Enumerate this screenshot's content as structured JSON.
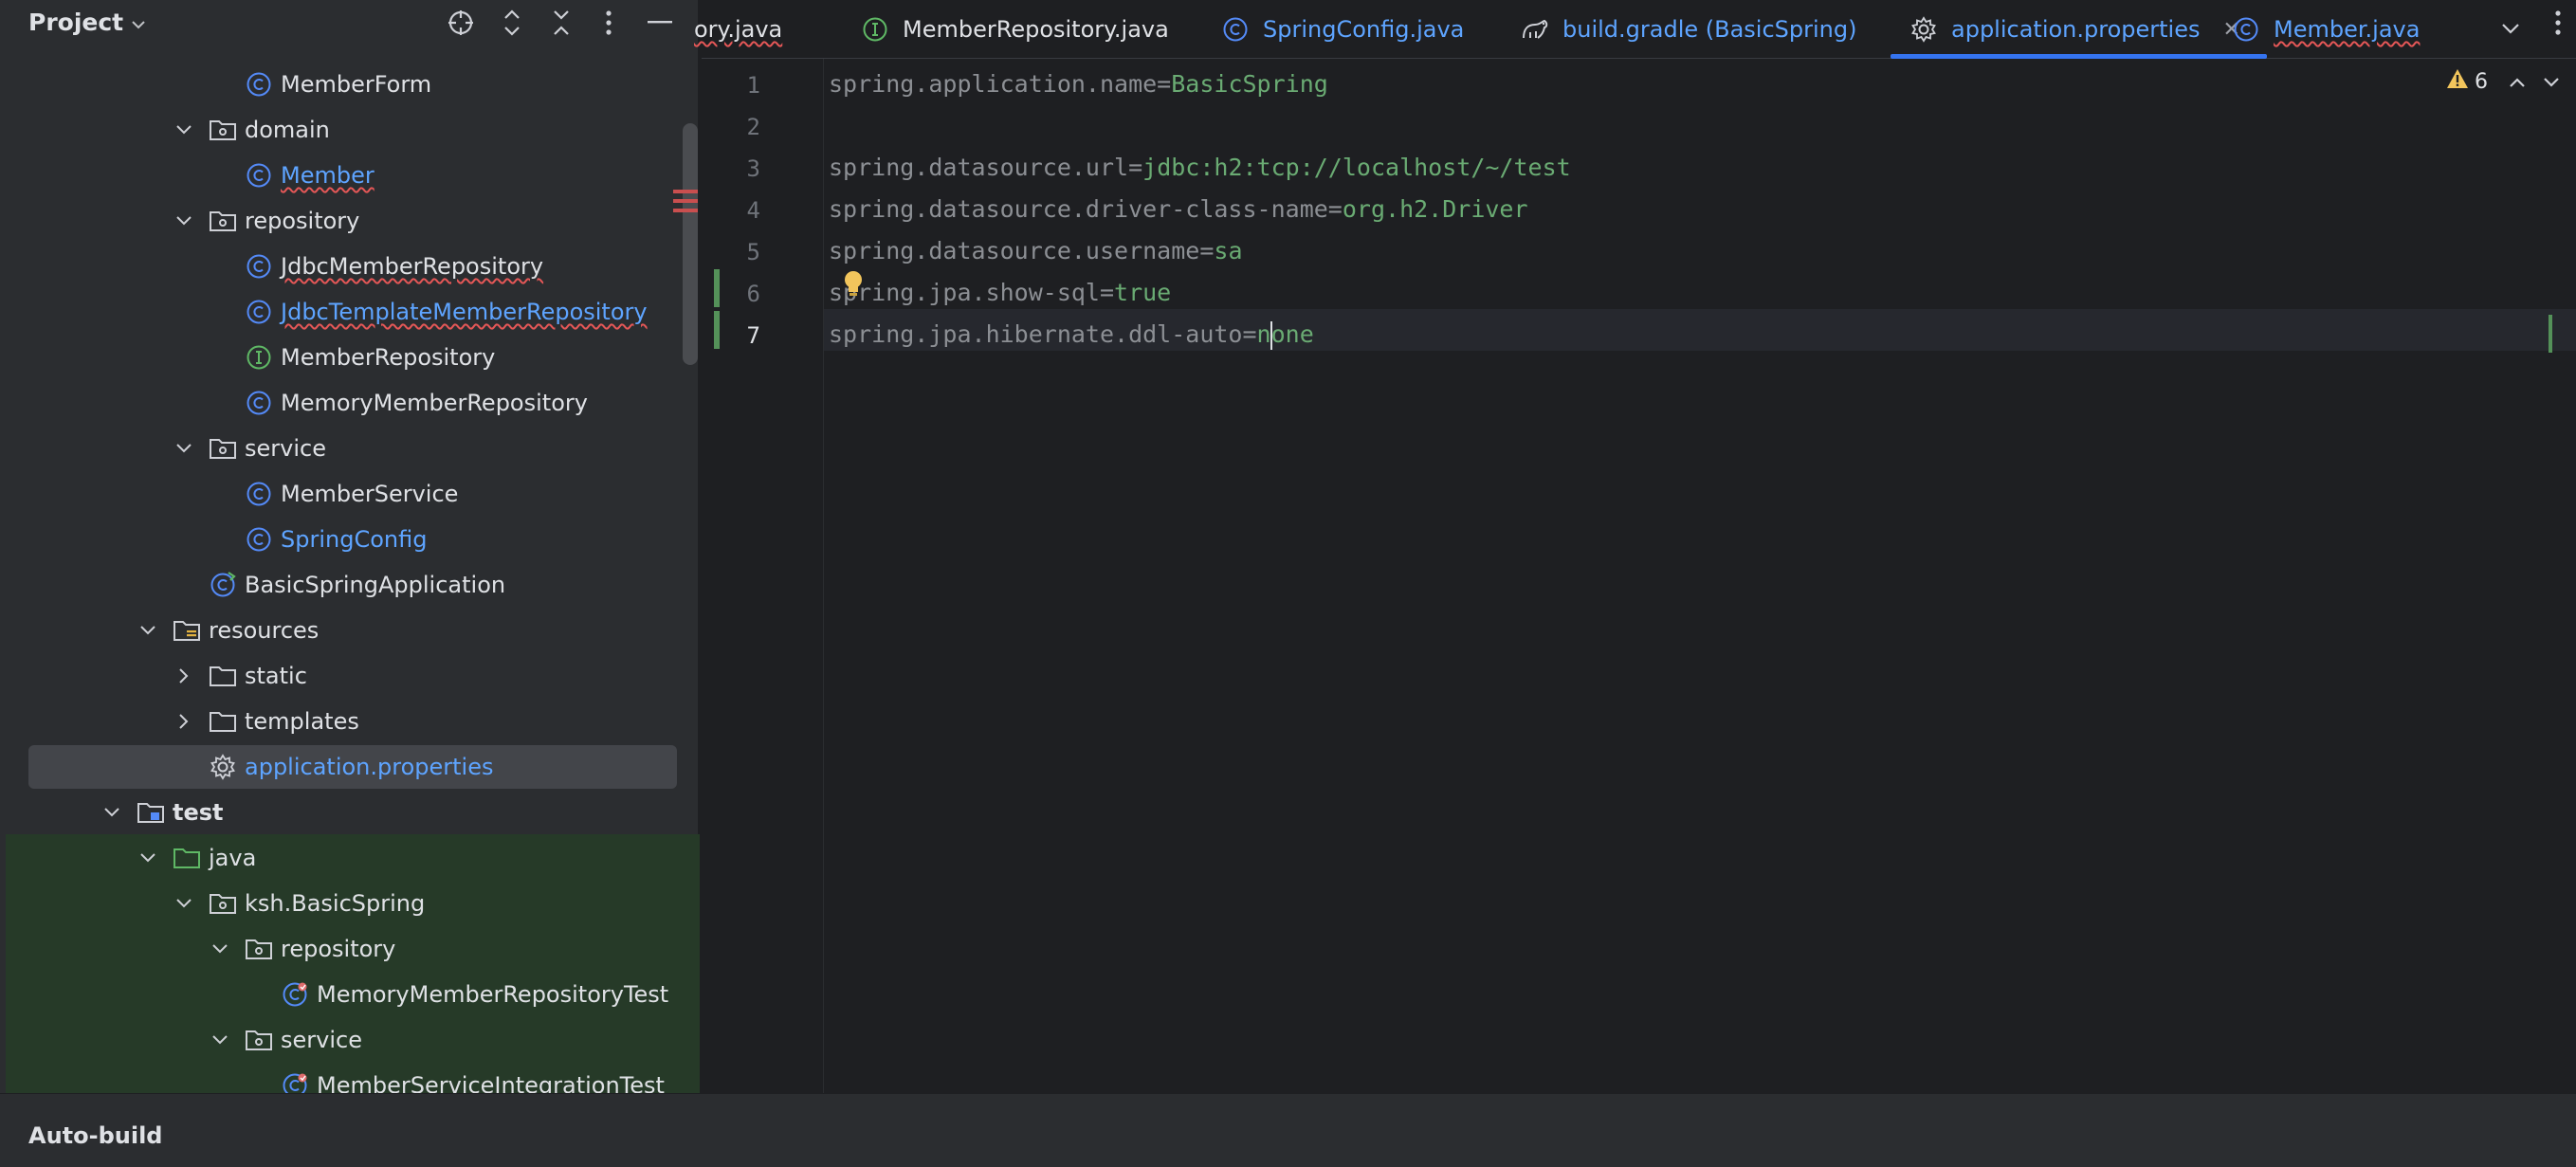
{
  "project_panel": {
    "title": "Project",
    "icons": [
      "locate-icon",
      "expand-all-icon",
      "collapse-all-icon",
      "more-options-icon",
      "minimize-icon"
    ]
  },
  "tree": [
    {
      "label": "MemberForm",
      "icon": "class-icon"
    },
    {
      "label": "domain",
      "icon": "package-icon",
      "expanded": true
    },
    {
      "label": "Member",
      "icon": "class-icon",
      "color": "blue",
      "error": true
    },
    {
      "label": "repository",
      "icon": "package-icon",
      "expanded": true
    },
    {
      "label": "JdbcMemberRepository",
      "icon": "class-icon",
      "error": true
    },
    {
      "label": "JdbcTemplateMemberRepository",
      "icon": "class-icon",
      "color": "blue",
      "error": true
    },
    {
      "label": "MemberRepository",
      "icon": "interface-icon"
    },
    {
      "label": "MemoryMemberRepository",
      "icon": "class-icon"
    },
    {
      "label": "service",
      "icon": "package-icon",
      "expanded": true
    },
    {
      "label": "MemberService",
      "icon": "class-icon"
    },
    {
      "label": "SpringConfig",
      "icon": "class-icon",
      "color": "blue"
    },
    {
      "label": "BasicSpringApplication",
      "icon": "spring-boot-class-icon"
    },
    {
      "label": "resources",
      "icon": "resources-folder-icon",
      "expanded": true
    },
    {
      "label": "static",
      "icon": "folder-icon",
      "expanded": false
    },
    {
      "label": "templates",
      "icon": "folder-icon",
      "expanded": false
    },
    {
      "label": "application.properties",
      "icon": "gear-icon",
      "color": "blue",
      "selected": true
    },
    {
      "label": "test",
      "icon": "test-module-icon",
      "expanded": true,
      "bold": true
    },
    {
      "label": "java",
      "icon": "test-folder-icon",
      "expanded": true
    },
    {
      "label": "ksh.BasicSpring",
      "icon": "package-icon",
      "expanded": true
    },
    {
      "label": "repository",
      "icon": "package-icon",
      "expanded": true
    },
    {
      "label": "MemoryMemberRepositoryTest",
      "icon": "test-class-icon"
    },
    {
      "label": "service",
      "icon": "package-icon",
      "expanded": true
    },
    {
      "label": "MemberServiceIntegrationTest",
      "icon": "test-class-icon"
    }
  ],
  "tabs": [
    {
      "label": "ory.java",
      "icon": "",
      "squiggle": true
    },
    {
      "label": "MemberRepository.java",
      "icon": "interface-icon"
    },
    {
      "label": "SpringConfig.java",
      "icon": "class-icon",
      "color": "blue"
    },
    {
      "label": "build.gradle (BasicSpring)",
      "icon": "gradle-icon",
      "color": "blue"
    },
    {
      "label": "application.properties",
      "icon": "gear-icon",
      "color": "blue",
      "active": true,
      "close": "✕"
    },
    {
      "label": "Member.java",
      "icon": "class-icon",
      "color": "blue",
      "squiggle": true
    }
  ],
  "editor": {
    "warning_count": "6",
    "current_line": 7,
    "lines": [
      {
        "num": "1",
        "key": "spring.application.name=",
        "value": "BasicSpring"
      },
      {
        "num": "2",
        "key": "",
        "value": ""
      },
      {
        "num": "3",
        "key": "spring.datasource.url=",
        "value": "jdbc:h2:tcp://localhost/~/test"
      },
      {
        "num": "4",
        "key": "spring.datasource.driver-class-name=",
        "value": "org.h2.Driver"
      },
      {
        "num": "5",
        "key": "spring.datasource.username=",
        "value": "sa"
      },
      {
        "num": "6",
        "key": "spring.jpa.show-sql=",
        "value": "true"
      },
      {
        "num": "7",
        "key": "spring.jpa.hibernate.ddl-auto=",
        "value_before_caret": "n",
        "value_after_caret": "one"
      }
    ]
  },
  "bottom_bar": {
    "label": "Auto-build"
  },
  "colors": {
    "accent": "#3574f0",
    "link_blue": "#5ea4ff",
    "property_value_green": "#6aab73",
    "vcs_modified_green": "#549159",
    "error_red": "#e55757",
    "warning_yellow": "#f2c55c"
  }
}
